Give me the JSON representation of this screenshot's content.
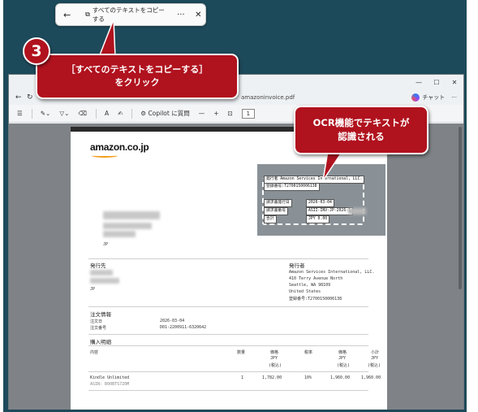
{
  "snip_bar": {
    "copy_label": "すべてのテキストをコピーする",
    "back_icon": "←",
    "copy_icon": "⧉",
    "more_icon": "···",
    "close_icon": "✕"
  },
  "step": {
    "number": "3"
  },
  "callouts": {
    "copy_line1": "［すべてのテキストをコピーする］",
    "copy_line2": "をクリック",
    "ocr_line1": "OCR機能でテキストが",
    "ocr_line2": "認識される"
  },
  "browser": {
    "url_tail": "amazoninvoice.pdf",
    "copilot_label": "チャット",
    "toolbar": {
      "copilot_label": "Copilot に質問",
      "page_box": "1"
    }
  },
  "invoice": {
    "logo": "amazon.co.jp",
    "recipient_country": "JP",
    "issuer_heading": "発行先",
    "issuer_country": "JP",
    "publisher_heading": "発行者",
    "publisher_lines": [
      "Amazon Services International, LLC.",
      "410 Terry Avenue North",
      "Seattle, WA 98109",
      "United States",
      "登録番号:T2700150006138"
    ],
    "order_heading": "注文情報",
    "order_date_label": "注文日",
    "order_date": "2026-03-04",
    "order_no_label": "注文番号",
    "order_no": "D01-2200911-6320642",
    "purchase_heading": "購入明細",
    "columns": {
      "content": "内容",
      "qty": "数量",
      "unit_price": "価格",
      "unit_price_cur": "JPY",
      "unit_price_tax": "(税込)",
      "tax_rate": "税率",
      "amount": "価格",
      "amount_cur": "JPY",
      "amount_tax": "(税込)",
      "subtotal": "小計",
      "subtotal_cur": "JPY",
      "subtotal_tax": "(税込)"
    },
    "row": {
      "item": "Kindle Unlimited",
      "code": "ASIN: B00BTS7Z0M",
      "qty": "1",
      "unit_price": "1,782.00",
      "tax_rate": "10%",
      "amount": "1,960.00",
      "subtotal": "1,960.00"
    },
    "ocr": {
      "publisher": "発行者 Amazon Services International, LLC.",
      "reg_no": "登録番号:T2700150006138",
      "issue_date_label": "請求書発行日",
      "issue_date": "2026-03-04",
      "invoice_no_label": "請求書番号",
      "invoice_no": "ASII-INV-JP-2026-1",
      "total_label": "合計",
      "total": "JPY 0.00"
    }
  }
}
